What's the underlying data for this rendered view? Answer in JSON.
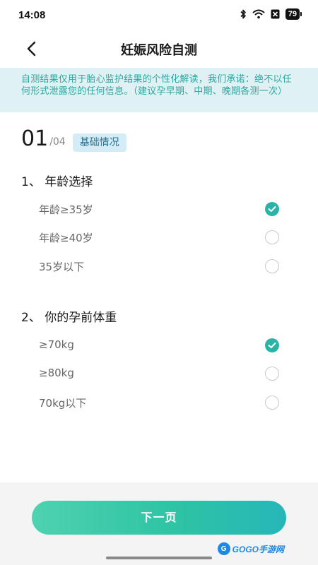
{
  "status_bar": {
    "time": "14:08",
    "battery": "79",
    "icons": [
      "bluetooth-icon",
      "wifi-icon",
      "sim-off-icon",
      "battery-icon"
    ]
  },
  "nav": {
    "title": "妊娠风险自测",
    "back_icon": "chevron-left-icon"
  },
  "notice": {
    "text": "自测结果仅用于胎心监护结果的个性化解读，我们承诺：绝不以任何形式泄露您的任何信息。（建议孕早期、中期、晚期各测一次）"
  },
  "step": {
    "current": "01",
    "total": "/04",
    "badge": "基础情况"
  },
  "questions": [
    {
      "title": "1、 年龄选择",
      "options": [
        {
          "label": "年龄≥35岁",
          "selected": true
        },
        {
          "label": "年龄≥40岁",
          "selected": false
        },
        {
          "label": "35岁以下",
          "selected": false
        }
      ]
    },
    {
      "title": "2、 你的孕前体重",
      "options": [
        {
          "label": "≥70kg",
          "selected": true
        },
        {
          "label": "≥80kg",
          "selected": false
        },
        {
          "label": "70kg以下",
          "selected": false
        }
      ]
    }
  ],
  "footer": {
    "next_label": "下一页",
    "watermark": "GOGO手游网"
  },
  "colors": {
    "accent": "#2bb3a8",
    "notice_bg": "#dff1f3",
    "notice_text": "#2aa8a0",
    "badge_bg": "#d4ecf5"
  }
}
